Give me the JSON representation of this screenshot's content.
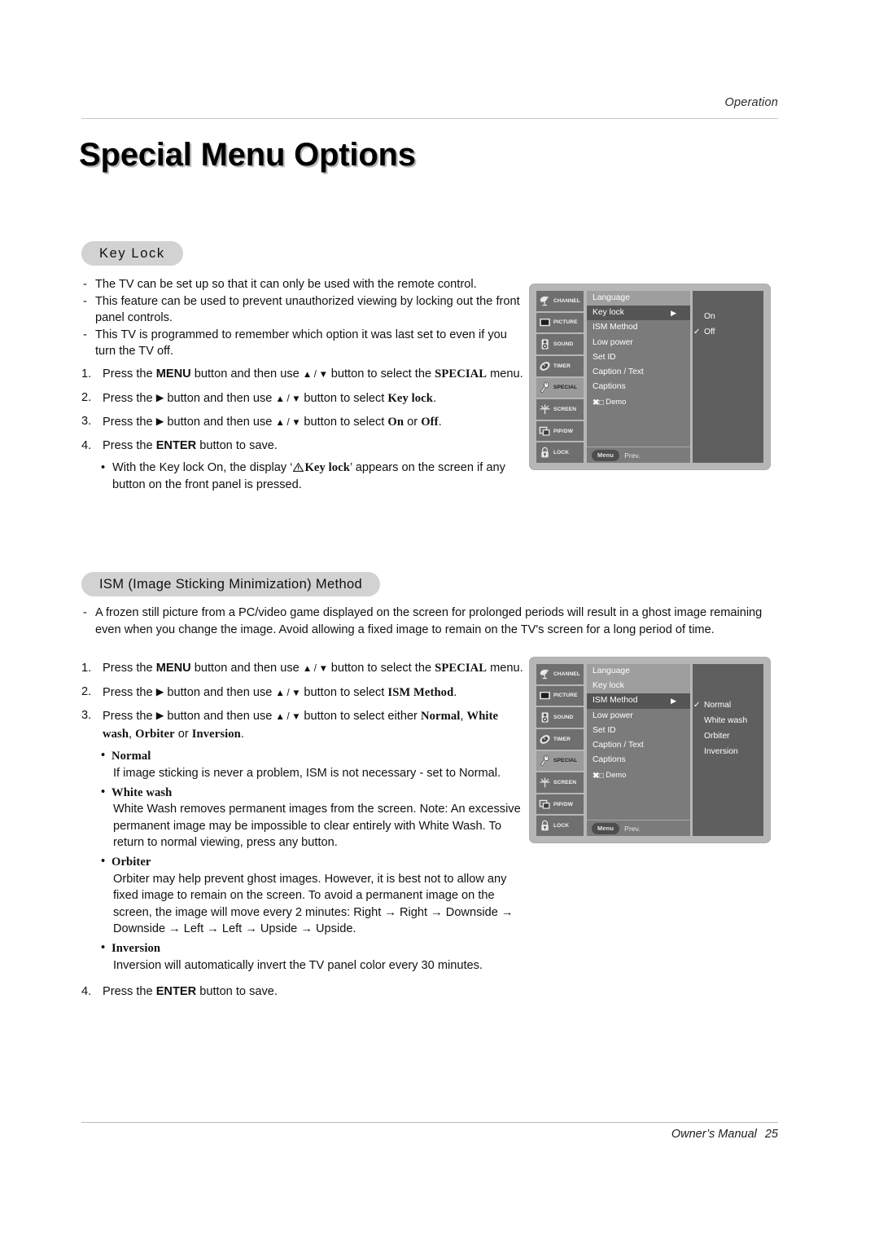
{
  "header": {
    "running_head": "Operation"
  },
  "title": "Special Menu Options",
  "sections": {
    "key_lock": {
      "pill": "Key Lock",
      "dashes": [
        "The TV can be set up so that it can only be used with the remote control.",
        "This feature can be used to prevent unauthorized viewing by locking out the front panel controls.",
        "This TV is programmed to remember which option it was last set to even if you turn the TV off."
      ],
      "steps": [
        {
          "n": "1.",
          "pre": "Press the ",
          "b1": "MENU",
          "mid": " button and then use ",
          "updn": "▲ / ▼",
          "mid2": " button to select the ",
          "b2": "SPECIAL",
          "post": " menu."
        },
        {
          "n": "2.",
          "pre": "Press the ",
          "arrow": "▶",
          "mid": " button and then use ",
          "updn": "▲ / ▼",
          "mid2": " button to select ",
          "b2": "Key lock",
          "post": "."
        },
        {
          "n": "3.",
          "pre": "Press the ",
          "arrow": "▶",
          "mid": " button and then use ",
          "updn": "▲ / ▼",
          "mid2": " button to select ",
          "b2": "On",
          "joiner": " or ",
          "b3": "Off",
          "post": "."
        },
        {
          "n": "4.",
          "pre": "Press the ",
          "b1": "ENTER",
          "post": " button to save."
        }
      ],
      "note_pre": "With the Key lock On, the display ‘",
      "note_bold": "Key lock",
      "note_post": "’ appears on the screen if any button on the front panel is pressed."
    },
    "ism": {
      "pill": "ISM (Image Sticking Minimization) Method",
      "dashes": [
        "A frozen still picture from a PC/video game displayed on the screen for prolonged periods will result in a ghost image remaining even when you change the image. Avoid allowing a fixed image to remain on the TV's screen for a long period of time."
      ],
      "steps": [
        {
          "n": "1.",
          "pre": "Press the ",
          "b1": "MENU",
          "mid": " button and then use ",
          "updn": "▲ / ▼",
          "mid2": " button to select the ",
          "b2": "SPECIAL",
          "post": " menu."
        },
        {
          "n": "2.",
          "pre": "Press the ",
          "arrow": "▶",
          "mid": " button and then use ",
          "updn": "▲ / ▼",
          "mid2": " button to select ",
          "b2": "ISM Method",
          "post": "."
        },
        {
          "n": "3.",
          "pre": "Press the ",
          "arrow": "▶",
          "mid": " button and then use ",
          "updn": "▲ / ▼",
          "mid2": " button to select either ",
          "b2": "Normal",
          "joiner": ", ",
          "b3": "White wash",
          "joiner2": ", ",
          "b4": "Orbiter",
          "joiner3": " or ",
          "b5": "Inversion",
          "post": "."
        }
      ],
      "bullets": [
        {
          "title": "Normal",
          "body": "If image sticking is never a problem, ISM is not necessary - set to Normal."
        },
        {
          "title": "White wash",
          "body": "White Wash removes permanent images from the screen. Note: An excessive permanent image may be impossible to clear entirely with White Wash. To return to normal viewing, press any button."
        },
        {
          "title": "Orbiter",
          "body": "Orbiter may help prevent ghost images. However, it is best not to allow any fixed image to remain on the screen. To avoid a permanent image on the screen, the image will move every 2 minutes: Right → Right → Downside → Downside → Left → Left → Upside → Upside."
        },
        {
          "title": "Inversion",
          "body": "Inversion will automatically invert the TV panel color every 30 minutes."
        }
      ],
      "final_step": {
        "n": "4.",
        "pre": "Press the ",
        "b1": "ENTER",
        "post": " button to save."
      }
    }
  },
  "osd": {
    "rail": [
      {
        "label": "CHANNEL",
        "icon": "satellite-dish-icon",
        "active": false
      },
      {
        "label": "PICTURE",
        "icon": "tv-screen-icon",
        "active": false
      },
      {
        "label": "SOUND",
        "icon": "speaker-icon",
        "active": false
      },
      {
        "label": "TIMER",
        "icon": "clock-icon",
        "active": false
      },
      {
        "label": "SPECIAL",
        "icon": "paint-roller-icon",
        "active": true
      },
      {
        "label": "SCREEN",
        "icon": "crosshair-icon",
        "active": false
      },
      {
        "label": "PIP/DW",
        "icon": "pip-windows-icon",
        "active": false
      },
      {
        "label": "LOCK",
        "icon": "padlock-icon",
        "active": false
      }
    ],
    "menu_items": [
      "Language",
      "Key lock",
      "ISM Method",
      "Low power",
      "Set ID",
      "Caption / Text",
      "Captions",
      "Demo"
    ],
    "xd_glyph": "✖□",
    "foot": {
      "menu_chip": "Menu",
      "prev": "Prev."
    },
    "keylock_panel": {
      "highlighted_item": "Language",
      "selected_item": "Key lock",
      "caret": "▶",
      "options": [
        {
          "label": "On",
          "checked": false
        },
        {
          "label": "Off",
          "checked": true
        }
      ],
      "check_glyph": "✓"
    },
    "ism_panel": {
      "highlighted_item": "Language",
      "selected_item": "ISM Method",
      "caret": "▶",
      "options": [
        {
          "label": "Normal",
          "checked": true
        },
        {
          "label": "White wash",
          "checked": false
        },
        {
          "label": "Orbiter",
          "checked": false
        },
        {
          "label": "Inversion",
          "checked": false
        }
      ],
      "check_glyph": "✓"
    }
  },
  "footer": {
    "manual": "Owner’s Manual",
    "page": "25"
  },
  "colors": {
    "pill_bg": "#d2d2d2",
    "osd_frame": "#b6b6b6",
    "osd_rail": "#6f6f6f",
    "osd_rail_active": "#9a9a9a",
    "osd_mid": "#7b7b7b",
    "osd_mid_highlight": "#9e9e9e",
    "osd_mid_selected": "#555555",
    "osd_right": "#5f5f5f"
  }
}
